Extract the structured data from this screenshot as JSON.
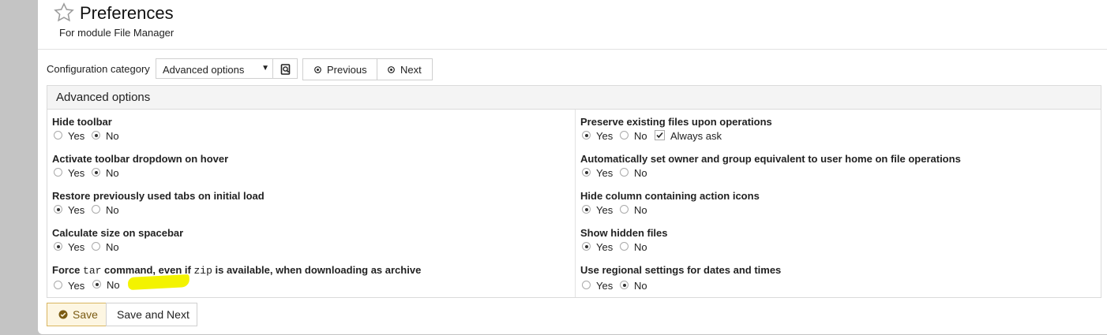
{
  "header": {
    "title": "Preferences",
    "subtitle": "For module File Manager"
  },
  "config": {
    "label": "Configuration category",
    "selected": "Advanced options",
    "previous_label": "Previous",
    "next_label": "Next"
  },
  "section": {
    "title": "Advanced options",
    "left": [
      {
        "label": "Hide toolbar",
        "yes": "Yes",
        "no": "No",
        "value": "no"
      },
      {
        "label": "Activate toolbar dropdown on hover",
        "yes": "Yes",
        "no": "No",
        "value": "no"
      },
      {
        "label": "Restore previously used tabs on initial load",
        "yes": "Yes",
        "no": "No",
        "value": "yes"
      },
      {
        "label": "Calculate size on spacebar",
        "yes": "Yes",
        "no": "No",
        "value": "yes"
      },
      {
        "label_pre": "Force ",
        "label_code1": "tar",
        "label_mid": " command, even if ",
        "label_code2": "zip",
        "label_post": " is available, when downloading as archive",
        "yes": "Yes",
        "no": "No",
        "value": "no"
      }
    ],
    "right": [
      {
        "label": "Preserve existing files upon operations",
        "yes": "Yes",
        "no": "No",
        "value": "yes",
        "extra": "Always ask",
        "extra_checked": true
      },
      {
        "label": "Automatically set owner and group equivalent to user home on file operations",
        "yes": "Yes",
        "no": "No",
        "value": "yes"
      },
      {
        "label": "Hide column containing action icons",
        "yes": "Yes",
        "no": "No",
        "value": "yes"
      },
      {
        "label": "Show hidden files",
        "yes": "Yes",
        "no": "No",
        "value": "yes"
      },
      {
        "label": "Use regional settings for dates and times",
        "yes": "Yes",
        "no": "No",
        "value": "no"
      }
    ]
  },
  "footer": {
    "save_label": "Save",
    "save_next_label": "Save and Next"
  },
  "colors": {
    "highlight": "#f3f300",
    "save_border": "#d9b55f"
  }
}
